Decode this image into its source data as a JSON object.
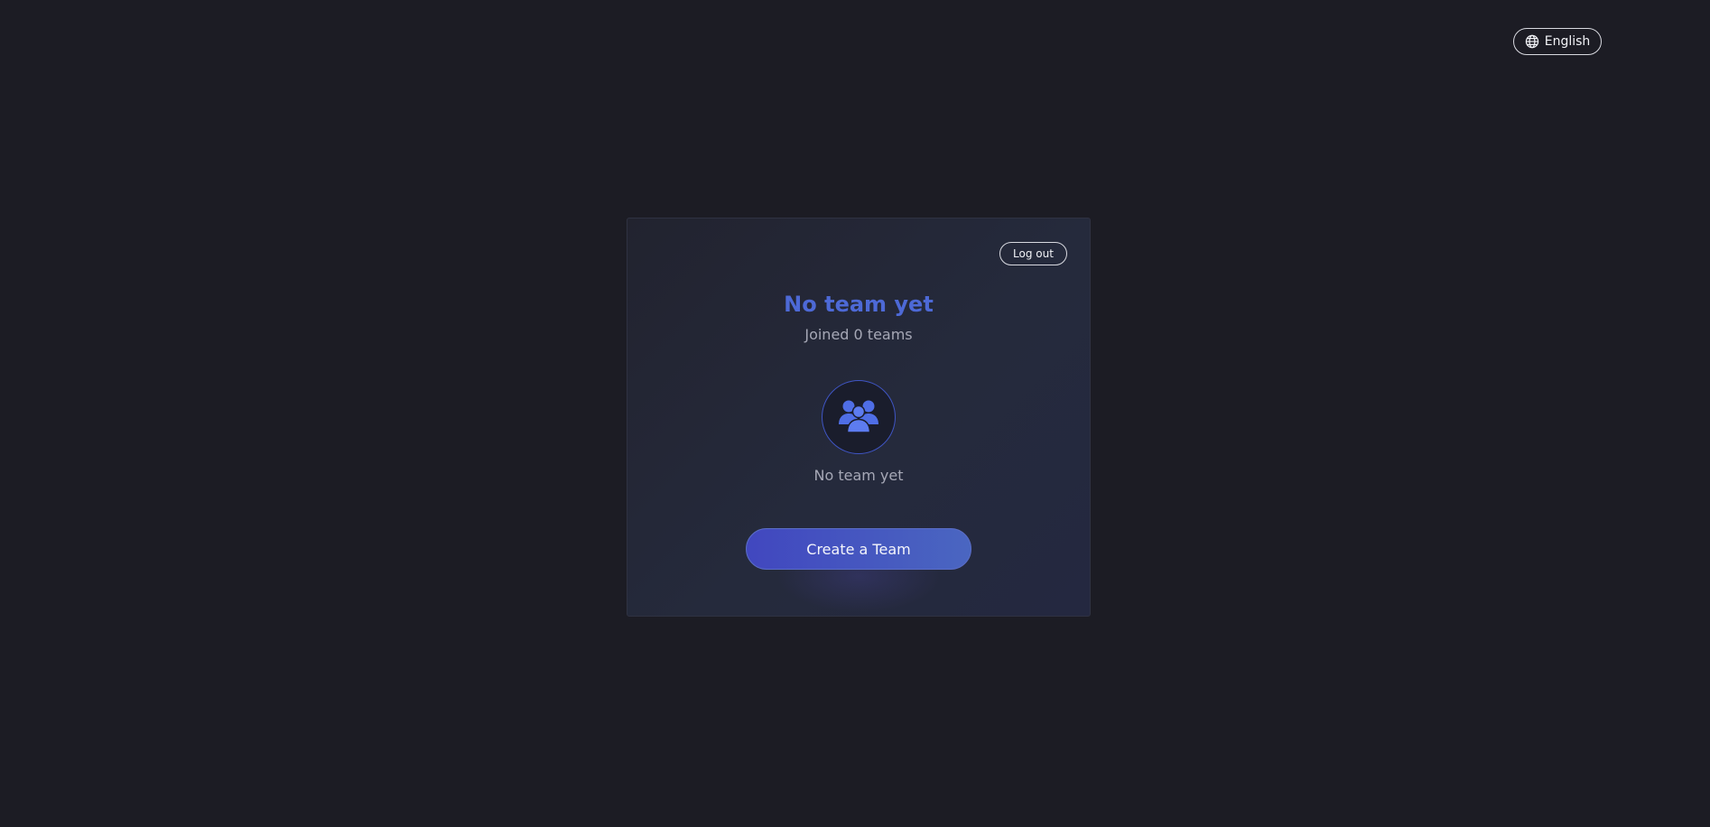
{
  "header": {
    "language_label": "English",
    "language_icon": "globe-icon"
  },
  "card": {
    "logout_label": "Log out",
    "title": "No team yet",
    "subtitle": "Joined 0 teams",
    "avatar_icon": "users-group-icon",
    "empty_label": "No team yet",
    "create_button_label": "Create a Team"
  },
  "colors": {
    "background": "#1c1c24",
    "accent": "#4d69d6",
    "button_gradient_start": "#4147bf",
    "button_gradient_end": "#4a66c1"
  }
}
